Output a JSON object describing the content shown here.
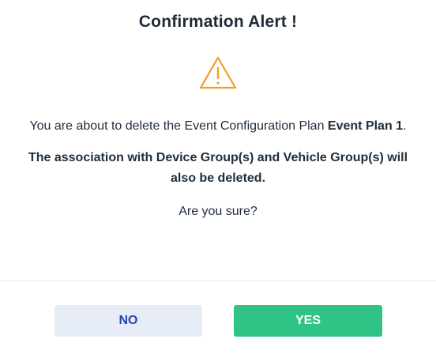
{
  "dialog": {
    "title": "Confirmation Alert !",
    "icon": "warning-triangle-icon",
    "accent_color": "#f0a020",
    "message": {
      "prefix": "You are about to delete the Event Configuration Plan ",
      "plan_name": "Event Plan 1",
      "suffix": "."
    },
    "association_warning": "The association with Device Group(s) and Vehicle Group(s) will also be deleted.",
    "question": "Are you sure?"
  },
  "buttons": {
    "no_label": "NO",
    "yes_label": "YES",
    "no_color": "#e6edf6",
    "yes_color": "#2fc486"
  }
}
